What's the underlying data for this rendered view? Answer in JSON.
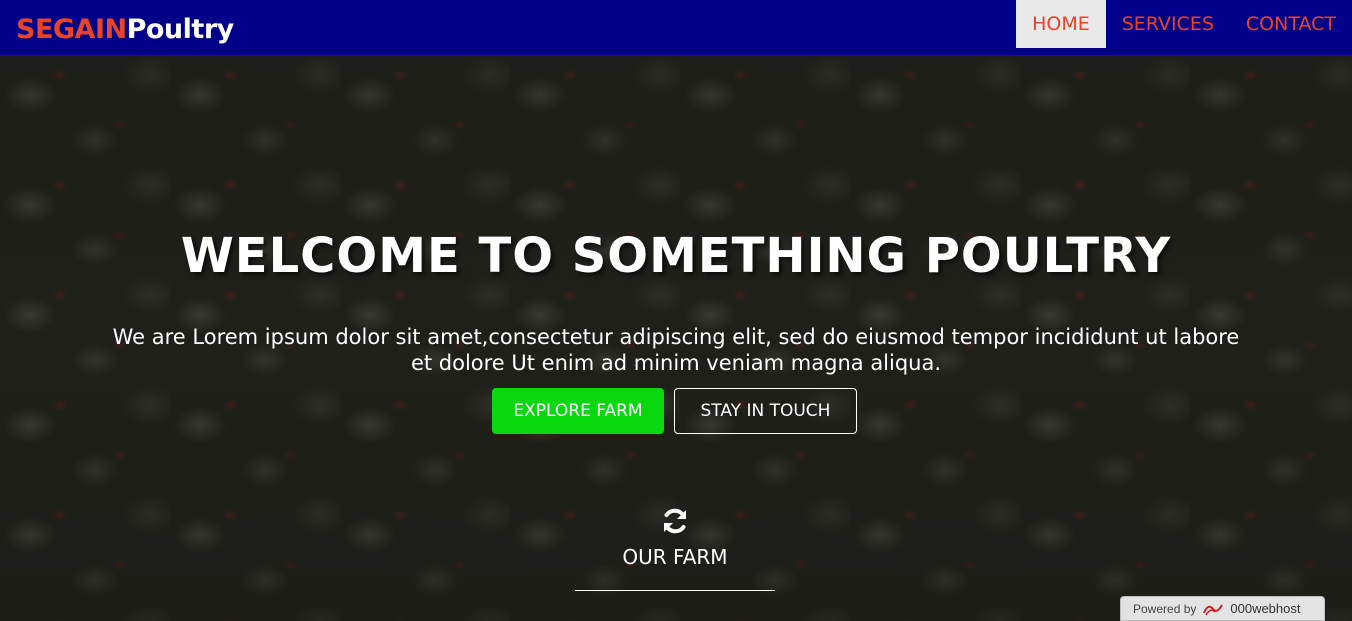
{
  "brand": {
    "part1": "SEGAIN",
    "part2": "Poultry",
    "part1_color": "#e8432b",
    "part2_color": "#ffffff"
  },
  "nav": {
    "items": [
      {
        "label": "HOME",
        "active": true
      },
      {
        "label": "SERVICES",
        "active": false
      },
      {
        "label": "CONTACT",
        "active": false
      }
    ],
    "background": "#000088",
    "link_color": "#e8432b"
  },
  "hero": {
    "title": "WELCOME TO SOMETHING POULTRY",
    "lead_line1": "We are Lorem ipsum dolor sit amet,consectetur adipiscing elit, sed do eiusmod tempor incididunt ut labore",
    "lead_line2": "et dolore Ut enim ad minim veniam magna aliqua.",
    "explore_button": "EXPLORE FARM",
    "touch_button": "STAY IN TOUCH",
    "explore_color": "#0ad80f"
  },
  "farm_section": {
    "icon": "refresh-icon",
    "label": "OUR FARM"
  },
  "footer_badge": {
    "powered_by": "Powered by",
    "host_name": "000webhost",
    "icon": "000webhost-logo-icon"
  }
}
